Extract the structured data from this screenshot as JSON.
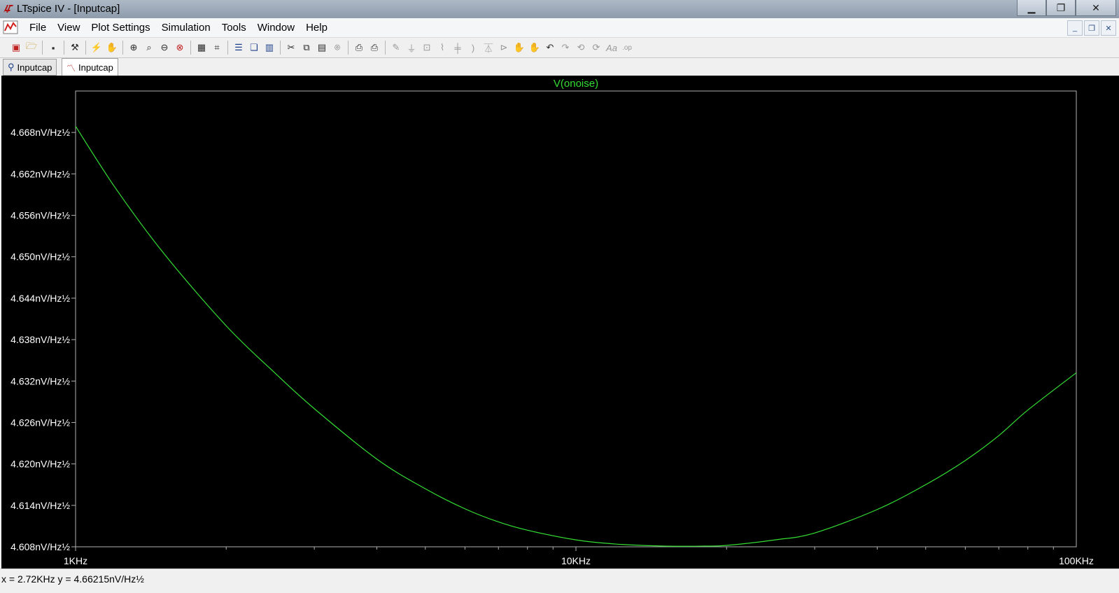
{
  "window": {
    "title": "LTspice IV - [Inputcap]"
  },
  "menu": [
    "File",
    "View",
    "Plot Settings",
    "Simulation",
    "Tools",
    "Window",
    "Help"
  ],
  "tabs": [
    {
      "label": "Inputcap",
      "icon": "schematic-icon",
      "active": false
    },
    {
      "label": "Inputcap",
      "icon": "waveform-icon",
      "active": true
    }
  ],
  "status": {
    "cursor_readout": "x = 2.72KHz    y = 4.66215nV/Hz½"
  },
  "colors": {
    "trace": "#33dd33",
    "plot_bg": "#000000",
    "axes": "#b0b0b0",
    "labels": "#ffffff"
  },
  "chart_data": {
    "type": "line",
    "title": "V(onoise)",
    "xlabel": "",
    "ylabel": "",
    "x_scale": "log",
    "xlim": [
      1000,
      100000
    ],
    "ylim": [
      4.608,
      4.674
    ],
    "x_tick_labels": [
      {
        "value": 1000,
        "label": "1KHz"
      },
      {
        "value": 10000,
        "label": "10KHz"
      },
      {
        "value": 100000,
        "label": "100KHz"
      }
    ],
    "y_tick_labels": [
      {
        "value": 4.668,
        "label": "4.668nV/Hz½"
      },
      {
        "value": 4.662,
        "label": "4.662nV/Hz½"
      },
      {
        "value": 4.656,
        "label": "4.656nV/Hz½"
      },
      {
        "value": 4.65,
        "label": "4.650nV/Hz½"
      },
      {
        "value": 4.644,
        "label": "4.644nV/Hz½"
      },
      {
        "value": 4.638,
        "label": "4.638nV/Hz½"
      },
      {
        "value": 4.632,
        "label": "4.632nV/Hz½"
      },
      {
        "value": 4.626,
        "label": "4.626nV/Hz½"
      },
      {
        "value": 4.62,
        "label": "4.620nV/Hz½"
      },
      {
        "value": 4.614,
        "label": "4.614nV/Hz½"
      },
      {
        "value": 4.608,
        "label": "4.608nV/Hz½"
      }
    ],
    "series": [
      {
        "x": [
          1000,
          1200,
          1500,
          2000,
          2500,
          3000,
          4000,
          5000,
          6000,
          7000,
          8000,
          10000,
          12000,
          15000,
          18000,
          20000,
          25000,
          30000,
          40000,
          50000,
          60000,
          70000,
          80000,
          100000
        ],
        "y": [
          4.6689,
          4.66,
          4.6505,
          4.64,
          4.6332,
          4.628,
          4.6207,
          4.6164,
          4.6135,
          4.6116,
          4.6104,
          4.609,
          4.6084,
          4.6081,
          4.6081,
          4.6082,
          4.609,
          4.61,
          4.6134,
          4.617,
          4.6205,
          4.6241,
          4.6278,
          4.6332
        ]
      }
    ]
  }
}
